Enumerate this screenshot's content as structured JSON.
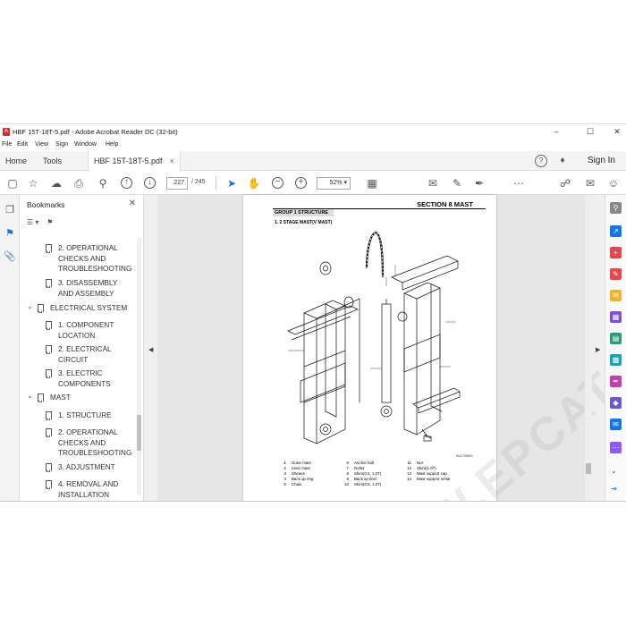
{
  "window": {
    "title": "HBF 15T-18T-5.pdf - Adobe Acrobat Reader DC (32-bit)",
    "minimize": "–",
    "maximize": "☐",
    "close": "✕"
  },
  "menu": [
    "File",
    "Edit",
    "View",
    "Sign",
    "Window",
    "Help"
  ],
  "tabs": {
    "home": "Home",
    "tools": "Tools",
    "document": "HBF 15T-18T-5.pdf",
    "close": "×",
    "sign_in": "Sign In"
  },
  "toolbar": {
    "current_page": "227",
    "total_pages": "/ 245",
    "zoom": "52%"
  },
  "bookmarks": {
    "header": "Bookmarks",
    "close": "✕",
    "items": [
      {
        "label": "2. OPERATIONAL CHECKS AND TROUBLESHOOTING",
        "level": 2
      },
      {
        "label": "3. DISASSEMBLY AND ASSEMBLY",
        "level": 2
      },
      {
        "label": "ELECTRICAL SYSTEM",
        "level": 1
      },
      {
        "label": "1. COMPONENT LOCATION",
        "level": 2
      },
      {
        "label": "2. ELECTRICAL CIRCUIT",
        "level": 2
      },
      {
        "label": "3. ELECTRIC COMPONENTS",
        "level": 2
      },
      {
        "label": "MAST",
        "level": 1
      },
      {
        "label": "1. STRUCTURE",
        "level": 2
      },
      {
        "label": "2. OPERATIONAL CHECKS AND TROUBLESHOOTING",
        "level": 2
      },
      {
        "label": "3. ADJUSTMENT",
        "level": 2
      },
      {
        "label": "4. REMOVAL AND INSTALLATION",
        "level": 2
      }
    ]
  },
  "page": {
    "section": "SECTION 8  MAST",
    "group": "GROUP 1  STRUCTURE",
    "subtitle": "1. 2 STAGE MAST(V MAST)",
    "figure_no": "HDC7MM01",
    "watermark": "WWW.EPCATALOG.COM",
    "legend": [
      {
        "n": "1",
        "t": "Outer mast"
      },
      {
        "n": "2",
        "t": "Inner mast"
      },
      {
        "n": "3",
        "t": "Sheave"
      },
      {
        "n": "4",
        "t": "Back up ring"
      },
      {
        "n": "5",
        "t": "Chain"
      },
      {
        "n": "6",
        "t": "Anchor bolt"
      },
      {
        "n": "7",
        "t": "Roller"
      },
      {
        "n": "8",
        "t": "Shim(0.5, 1.0T)"
      },
      {
        "n": "9",
        "t": "Back up liner"
      },
      {
        "n": "10",
        "t": "Shim(0.5, 1.0T)"
      },
      {
        "n": "11",
        "t": "Nut"
      },
      {
        "n": "12",
        "t": "Shim(1.0T)"
      },
      {
        "n": "13",
        "t": "Mast support cap"
      },
      {
        "n": "14",
        "t": "Mast support metal"
      }
    ]
  },
  "colors": {
    "accent": "#1473e6",
    "brand_red": "#d32f2f"
  }
}
